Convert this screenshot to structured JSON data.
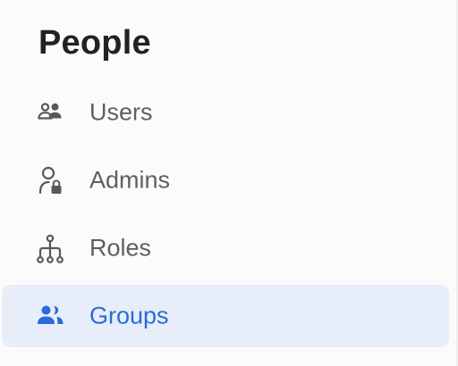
{
  "sidebar": {
    "section_title": "People",
    "accent_color": "#2a6bd9",
    "active_background": "#e7eef9",
    "items": [
      {
        "label": "Users",
        "icon": "users-icon",
        "active": false
      },
      {
        "label": "Admins",
        "icon": "admin-lock-icon",
        "active": false
      },
      {
        "label": "Roles",
        "icon": "hierarchy-icon",
        "active": false
      },
      {
        "label": "Groups",
        "icon": "group-icon",
        "active": true
      }
    ]
  }
}
